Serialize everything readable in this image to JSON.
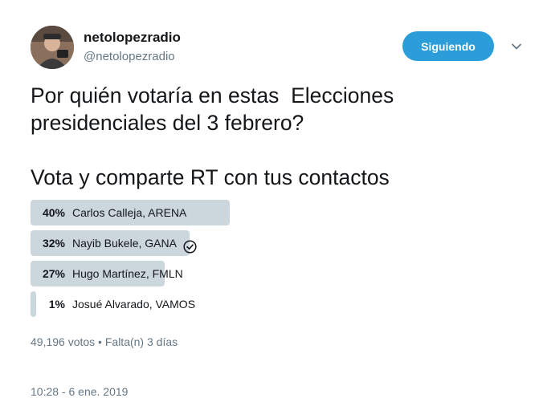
{
  "user": {
    "display_name": "netolopezradio",
    "handle": "@netolopezradio"
  },
  "follow_button": {
    "label": "Siguiendo"
  },
  "tweet": {
    "lines": [
      "Por quién votaría en estas  Elecciones",
      "presidenciales del 3 febrero?",
      "Vota y comparte RT con tus contactos"
    ]
  },
  "poll": {
    "options": [
      {
        "percent_label": "40%",
        "percent": 40,
        "label": "Carlos Calleja, ARENA",
        "winner": false
      },
      {
        "percent_label": "32%",
        "percent": 32,
        "label": "Nayib Bukele, GANA",
        "winner": true
      },
      {
        "percent_label": "27%",
        "percent": 27,
        "label": "Hugo Martínez, FMLN",
        "winner": false
      },
      {
        "percent_label": "1%",
        "percent": 1,
        "label": "Josué Alvarado, VAMOS",
        "winner": false
      }
    ],
    "meta": "49,196 votos • Falta(n) 3 días"
  },
  "timestamp": "10:28 - 6 ene. 2019",
  "colors": {
    "accent": "#2b9ed9",
    "poll_bar": "#ccd6dd",
    "secondary_text": "#657786"
  }
}
